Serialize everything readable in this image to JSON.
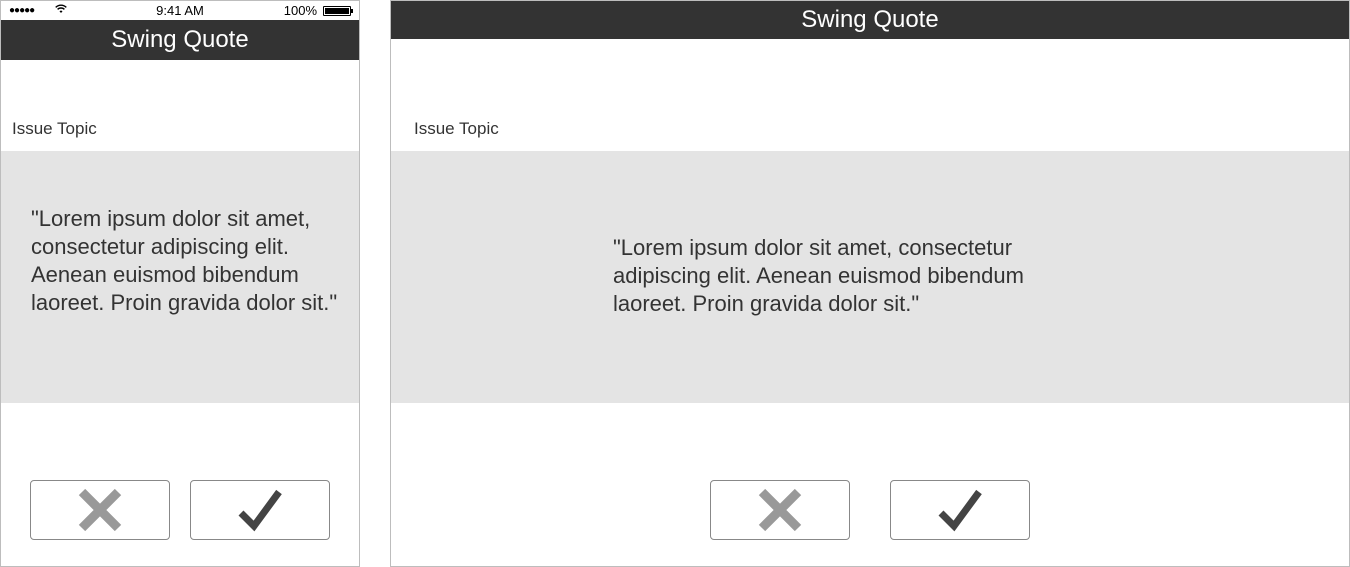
{
  "phone": {
    "status_bar": {
      "signal": "●●●●●",
      "time": "9:41 AM",
      "battery_percent": "100%",
      "battery_level": 1.0
    },
    "title": "Swing Quote",
    "topic_label": "Issue Topic",
    "quote": "\"Lorem ipsum dolor sit amet, consectetur adipiscing elit. Aenean euismod bibendum laoreet. Proin gravida dolor sit.\"",
    "buttons": {
      "cancel_icon": "close-icon",
      "confirm_icon": "checkmark-icon"
    }
  },
  "tablet": {
    "title": "Swing Quote",
    "topic_label": "Issue Topic",
    "quote": "\"Lorem ipsum dolor sit amet, consectetur adipiscing elit. Aenean euismod bibendum laoreet. Proin gravida dolor sit.\"",
    "buttons": {
      "cancel_icon": "close-icon",
      "confirm_icon": "checkmark-icon"
    }
  },
  "colors": {
    "title_bar": "#333333",
    "quote_panel": "#e4e4e4",
    "cancel_icon": "#999999",
    "confirm_icon": "#444444"
  }
}
